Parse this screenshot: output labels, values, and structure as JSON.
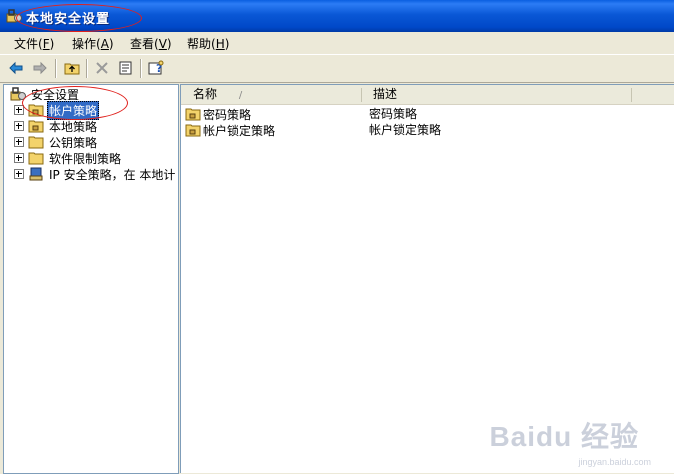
{
  "window": {
    "title": "本地安全设置"
  },
  "menu": [
    {
      "label": "文件",
      "key": "F"
    },
    {
      "label": "操作",
      "key": "A"
    },
    {
      "label": "查看",
      "key": "V"
    },
    {
      "label": "帮助",
      "key": "H"
    }
  ],
  "toolbar": {
    "icons": [
      "back-arrow-icon",
      "forward-arrow-icon",
      "up-folder-icon",
      "delete-icon",
      "properties-icon",
      "help-icon"
    ]
  },
  "tree": {
    "root": "安全设置",
    "items": [
      {
        "label": "帐户策略",
        "selected": true
      },
      {
        "label": "本地策略"
      },
      {
        "label": "公钥策略"
      },
      {
        "label": "软件限制策略"
      },
      {
        "label": "IP 安全策略，在 本地计"
      }
    ]
  },
  "list": {
    "columns": {
      "name": "名称",
      "sort_indicator": "/",
      "description": "描述"
    },
    "rows": [
      {
        "name": "密码策略",
        "description": "密码策略"
      },
      {
        "name": "帐户锁定策略",
        "description": "帐户锁定策略"
      }
    ]
  },
  "watermark": {
    "logo": "Baidu 经验",
    "url": "jingyan.baidu.com"
  },
  "colors": {
    "title_bar": "#0a58d6",
    "selection": "#316ac5",
    "annotation": "#e0201c"
  }
}
